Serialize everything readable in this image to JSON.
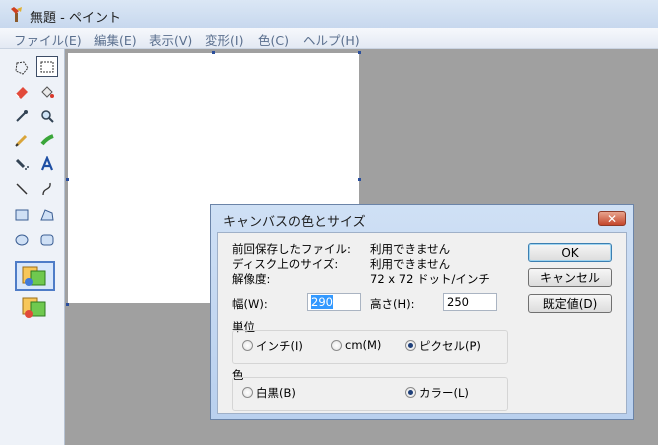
{
  "window": {
    "title": "無題 - ペイント"
  },
  "menu": [
    "ファイル(E)",
    "編集(E)",
    "表示(V)",
    "変形(I)",
    "色(C)",
    "ヘルプ(H)"
  ],
  "dialog": {
    "title": "キャンバスの色とサイズ",
    "close_label": "✕",
    "info": [
      {
        "label": "前回保存したファイル:",
        "value": "利用できません"
      },
      {
        "label": "ディスク上のサイズ:",
        "value": "利用できません"
      },
      {
        "label": "解像度:",
        "value": "72 x 72 ドット/インチ"
      }
    ],
    "width_label": "幅(W):",
    "width_value": "290",
    "height_label": "高さ(H):",
    "height_value": "250",
    "units_group": "単位",
    "units": [
      {
        "label": "インチ(I)",
        "selected": false
      },
      {
        "label": "cm(M)",
        "selected": false
      },
      {
        "label": "ピクセル(P)",
        "selected": true
      }
    ],
    "color_group": "色",
    "colors": [
      {
        "label": "白黒(B)",
        "selected": false
      },
      {
        "label": "カラー(L)",
        "selected": true
      }
    ],
    "buttons": {
      "ok": "OK",
      "cancel": "キャンセル",
      "default": "既定値(D)"
    }
  }
}
